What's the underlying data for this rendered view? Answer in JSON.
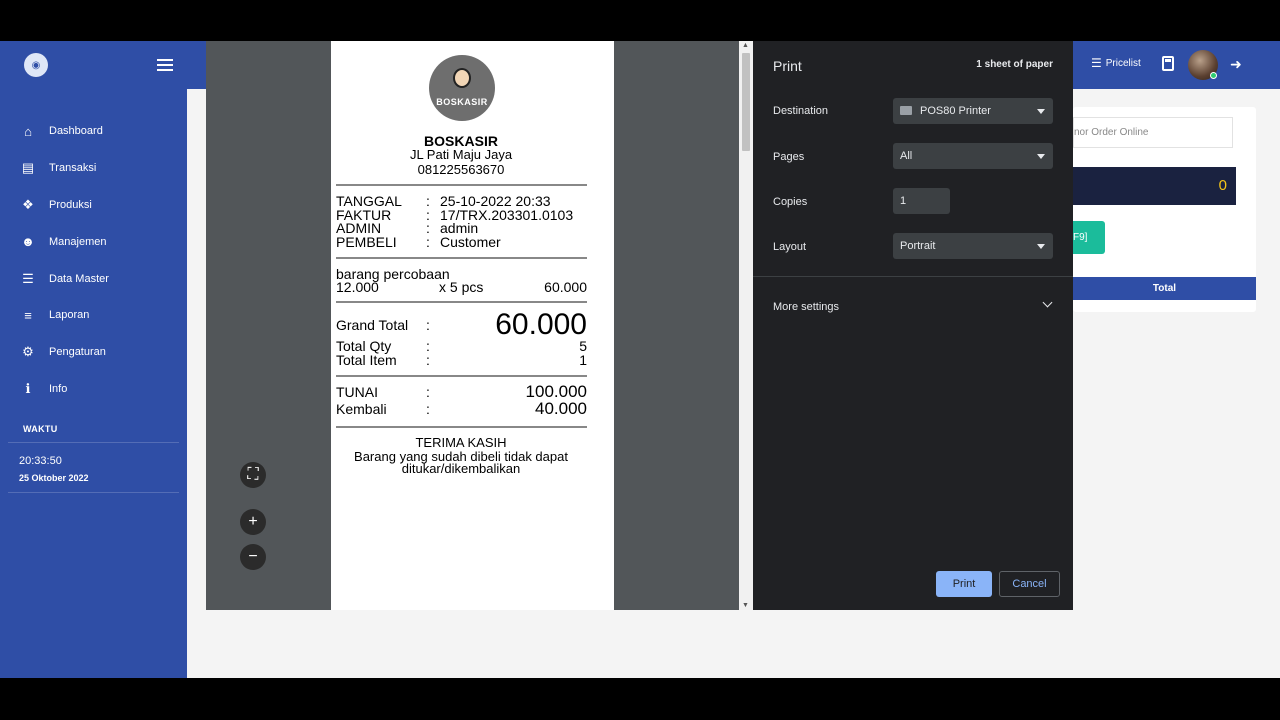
{
  "sidebar": {
    "logo_icon": "boskasir-logo",
    "items": [
      {
        "label": "Dashboard",
        "icon": "home-icon"
      },
      {
        "label": "Transaksi",
        "icon": "money-icon"
      },
      {
        "label": "Produksi",
        "icon": "cubes-icon"
      },
      {
        "label": "Manajemen",
        "icon": "users-icon"
      },
      {
        "label": "Data Master",
        "icon": "database-icon"
      },
      {
        "label": "Laporan",
        "icon": "list-icon"
      },
      {
        "label": "Pengaturan",
        "icon": "cogs-icon"
      },
      {
        "label": "Info",
        "icon": "info-icon"
      }
    ],
    "waktu_label": "WAKTU",
    "time": "20:33:50",
    "date": "25 Oktober 2022"
  },
  "topbar": {
    "pricelist_label": "Pricelist"
  },
  "main": {
    "order_placeholder": "nor Order Online",
    "total_value": "0",
    "teal_button_label": "F9]",
    "total_header": "Total"
  },
  "receipt": {
    "logo_text": "BOSKASIR",
    "store_name": "BOSKASIR",
    "address": "JL Pati Maju Jaya",
    "phone": "081225563670",
    "info": [
      {
        "key": "TANGGAL",
        "sep": ":",
        "value": "25-10-2022 20:33"
      },
      {
        "key": "FAKTUR",
        "sep": ":",
        "value": "17/TRX.203301.0103"
      },
      {
        "key": "ADMIN",
        "sep": ":",
        "value": "admin"
      },
      {
        "key": "PEMBELI",
        "sep": ":",
        "value": "Customer"
      }
    ],
    "item_name": "barang percobaan",
    "item_price": "12.000",
    "item_qty": "x 5 pcs",
    "item_subtotal": "60.000",
    "grand_total_label": "Grand Total",
    "grand_total_sep": ":",
    "grand_total_value": "60.000",
    "total_qty_label": "Total Qty",
    "total_qty_sep": ":",
    "total_qty_value": "5",
    "total_item_label": "Total Item",
    "total_item_sep": ":",
    "total_item_value": "1",
    "tunai_label": "TUNAI",
    "tunai_sep": ":",
    "tunai_value": "100.000",
    "kembali_label": "Kembali",
    "kembali_sep": ":",
    "kembali_value": "40.000",
    "thanks": "TERIMA KASIH",
    "note_line1": "Barang yang sudah dibeli tidak dapat",
    "note_line2": "ditukar/dikembalikan"
  },
  "print_dialog": {
    "title": "Print",
    "sheets": "1 sheet of paper",
    "destination_label": "Destination",
    "destination_value": "POS80 Printer",
    "pages_label": "Pages",
    "pages_value": "All",
    "copies_label": "Copies",
    "copies_value": "1",
    "layout_label": "Layout",
    "layout_value": "Portrait",
    "more_settings": "More settings",
    "print_button": "Print",
    "cancel_button": "Cancel"
  }
}
